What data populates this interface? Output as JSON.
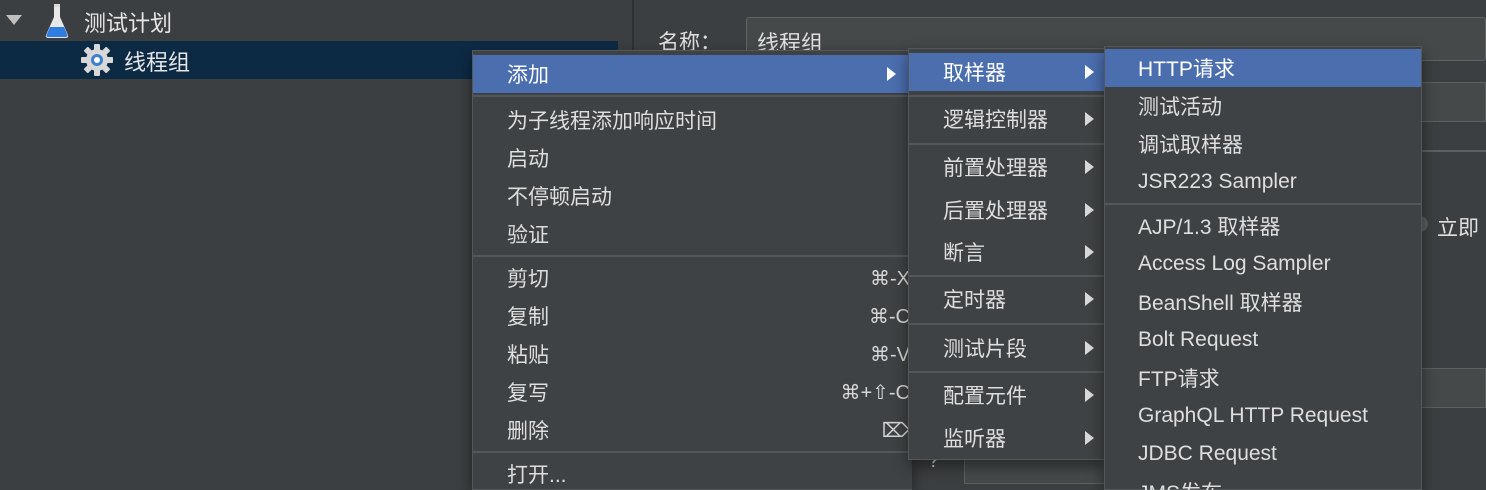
{
  "tree": {
    "items": [
      {
        "label": "测试计划"
      },
      {
        "label": "线程组"
      }
    ]
  },
  "panel": {
    "name_label": "名称：",
    "name_value": "线程组",
    "immediate_label": "立即",
    "qmark": "?"
  },
  "menu1": {
    "add": "添加",
    "items": [
      {
        "label": "为子线程添加响应时间",
        "shortcut": ""
      },
      {
        "label": "启动",
        "shortcut": ""
      },
      {
        "label": "不停顿启动",
        "shortcut": ""
      },
      {
        "label": "验证",
        "shortcut": ""
      },
      {
        "label": "剪切",
        "shortcut": "⌘-X"
      },
      {
        "label": "复制",
        "shortcut": "⌘-C"
      },
      {
        "label": "粘贴",
        "shortcut": "⌘-V"
      },
      {
        "label": "复写",
        "shortcut": "⌘+⇧-C"
      },
      {
        "label": "删除",
        "shortcut": "⌦"
      },
      {
        "label": "打开...",
        "shortcut": ""
      }
    ]
  },
  "menu2": {
    "items": [
      {
        "label": "取样器"
      },
      {
        "label": "逻辑控制器"
      },
      {
        "label": "前置处理器"
      },
      {
        "label": "后置处理器"
      },
      {
        "label": "断言"
      },
      {
        "label": "定时器"
      },
      {
        "label": "测试片段"
      },
      {
        "label": "配置元件"
      },
      {
        "label": "监听器"
      }
    ]
  },
  "menu3": {
    "items": [
      {
        "label": "HTTP请求"
      },
      {
        "label": "测试活动"
      },
      {
        "label": "调试取样器"
      },
      {
        "label": "JSR223 Sampler"
      },
      {
        "label": "AJP/1.3 取样器"
      },
      {
        "label": "Access Log Sampler"
      },
      {
        "label": "BeanShell 取样器"
      },
      {
        "label": "Bolt Request"
      },
      {
        "label": "FTP请求"
      },
      {
        "label": "GraphQL HTTP Request"
      },
      {
        "label": "JDBC Request"
      },
      {
        "label": "JMS发布"
      }
    ]
  },
  "colors": {
    "background": "#3c3f41",
    "selection": "#4b6eaf",
    "tree_selection": "#0d2a44"
  }
}
